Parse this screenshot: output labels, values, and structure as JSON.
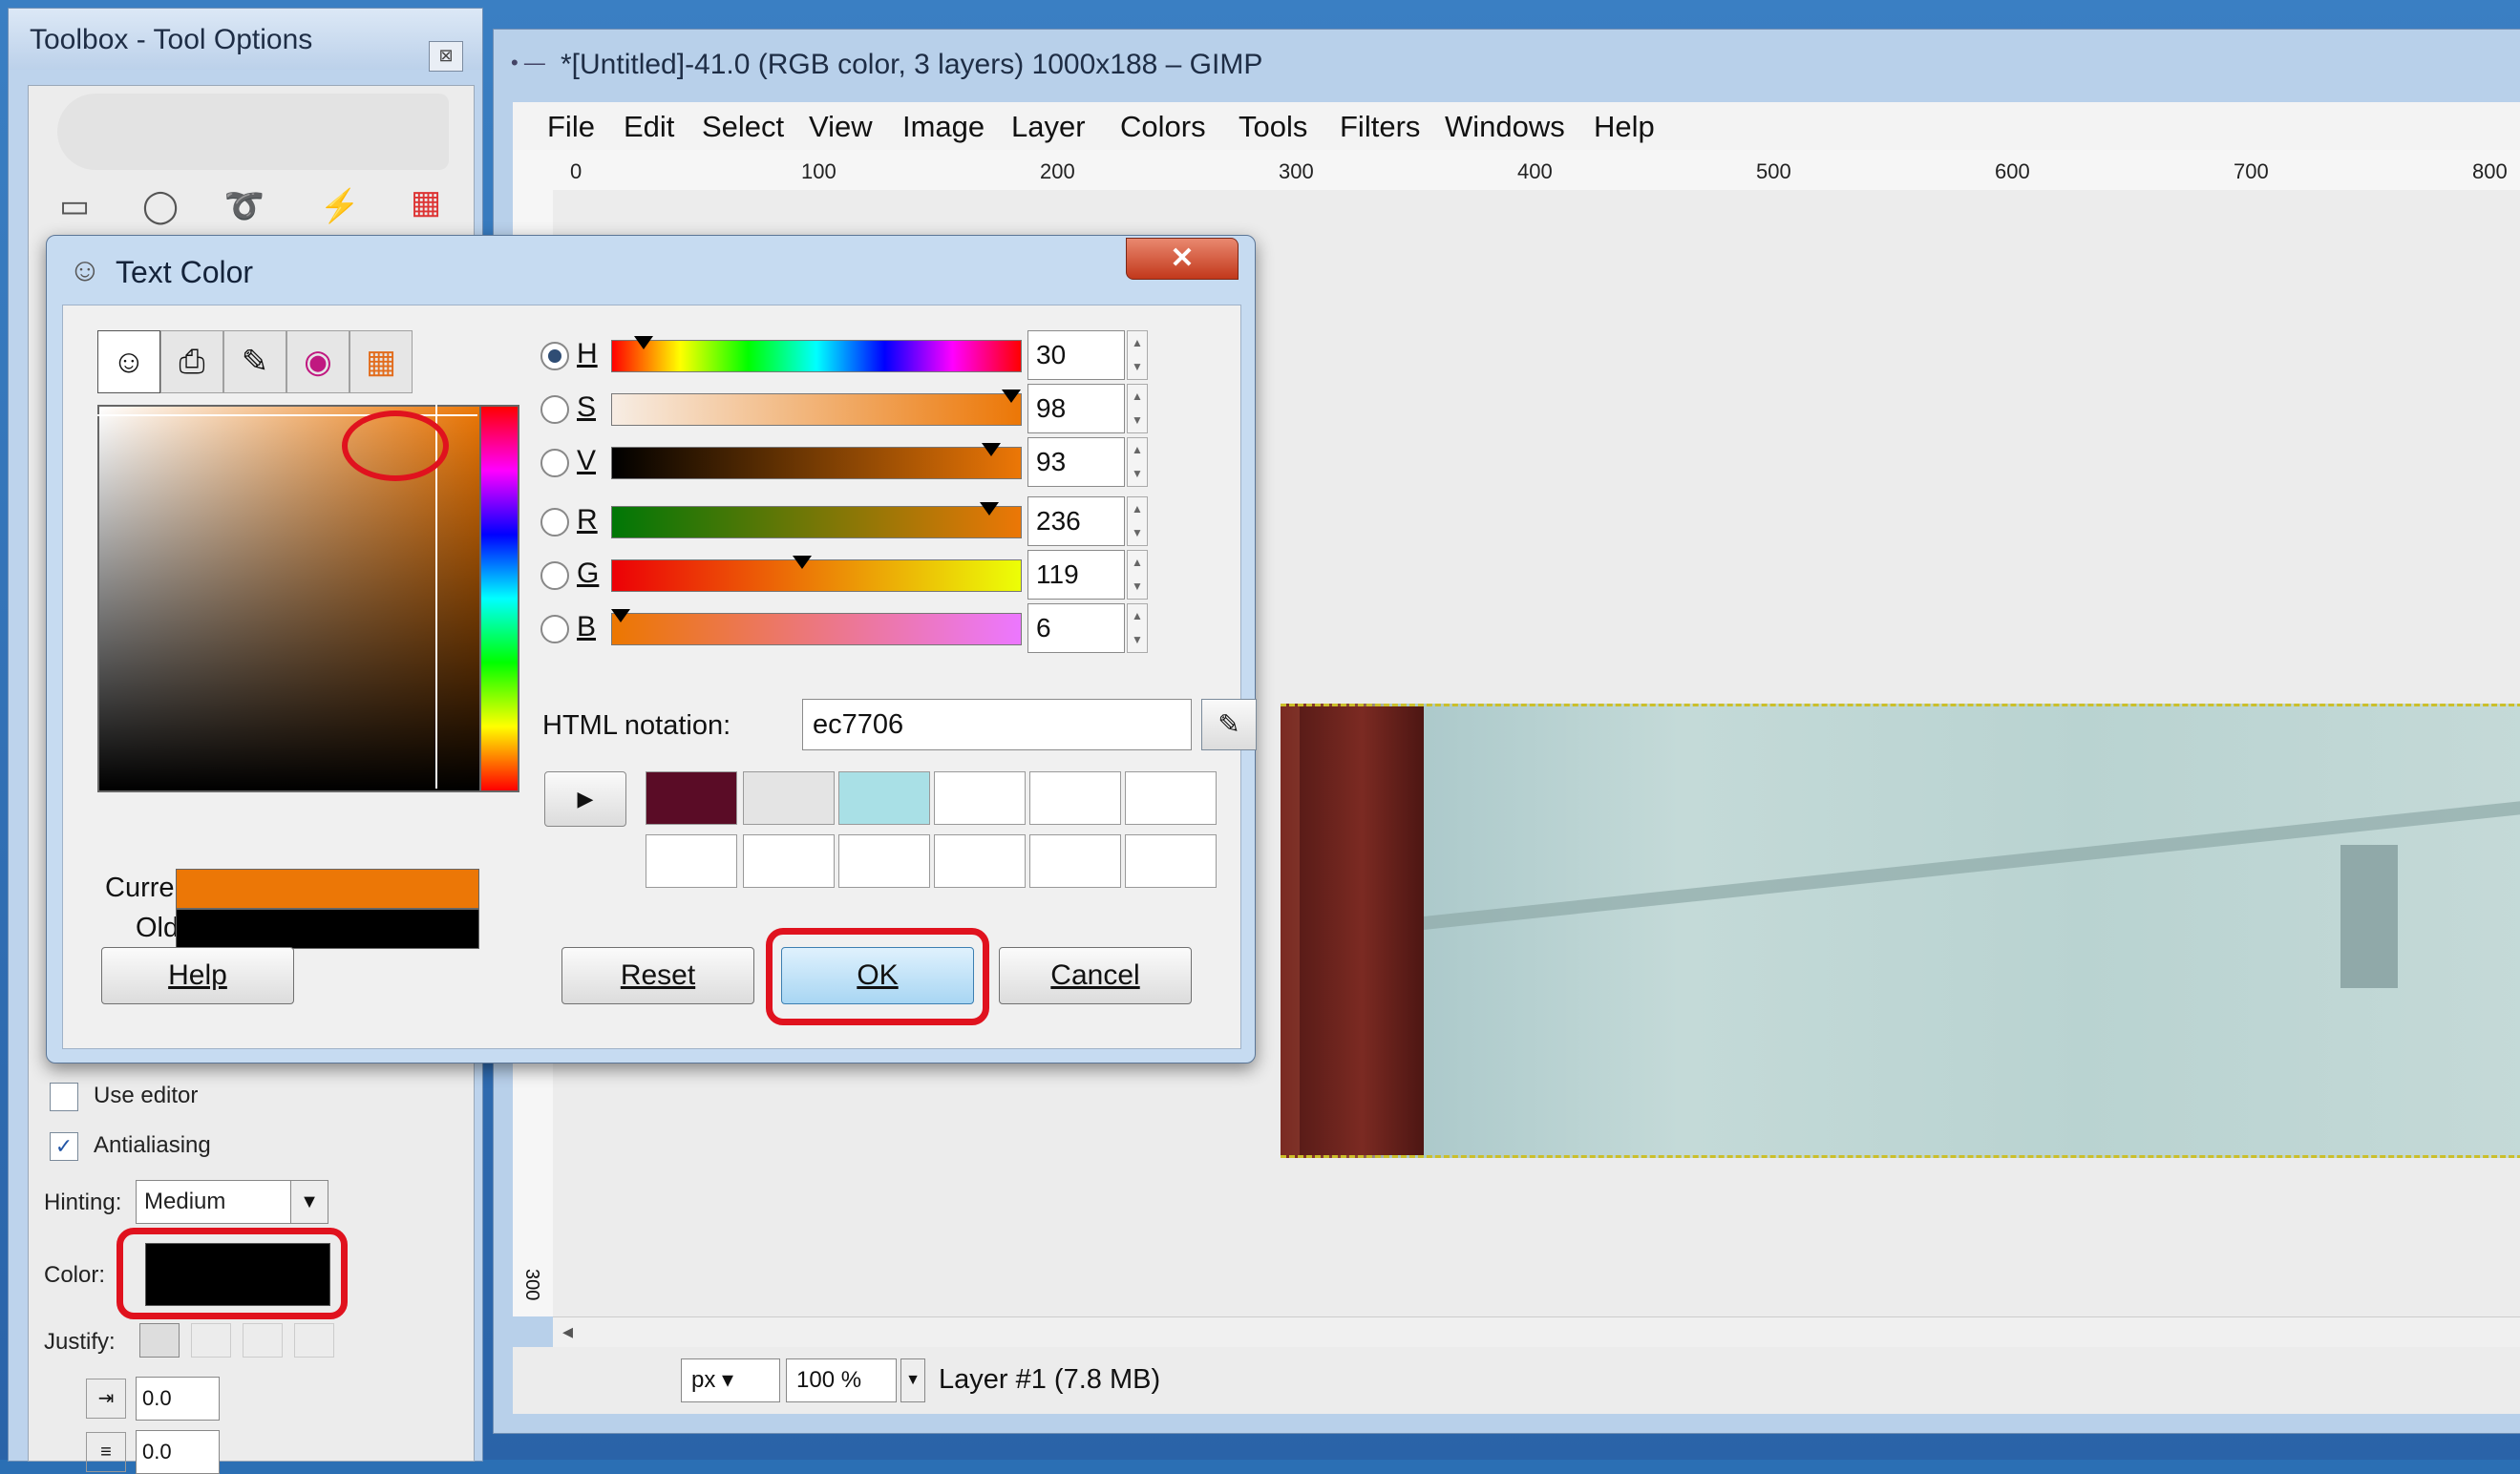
{
  "toolbox": {
    "title": "Toolbox - Tool Options",
    "close_label": "⊠",
    "tools": [
      "rect-select-icon",
      "ellipse-select-icon",
      "free-select-icon",
      "fuzzy-select-icon",
      "color-select-icon"
    ],
    "options": {
      "use_editor_label": "Use editor",
      "use_editor_checked": false,
      "antialiasing_label": "Antialiasing",
      "antialiasing_checked": true,
      "hinting_label": "Hinting:",
      "hinting_value": "Medium",
      "color_label": "Color:",
      "color_value": "#000000",
      "justify_label": "Justify:",
      "indent_value": "0.0",
      "line_spacing_value": "0.0"
    }
  },
  "main_window": {
    "title": "*[Untitled]-41.0 (RGB color, 3 layers) 1000x188 – GIMP",
    "menus": [
      "File",
      "Edit",
      "Select",
      "View",
      "Image",
      "Layer",
      "Colors",
      "Tools",
      "Filters",
      "Windows",
      "Help"
    ],
    "ruler_ticks": [
      "0",
      "100",
      "200",
      "300",
      "400",
      "500",
      "600",
      "700",
      "800"
    ],
    "vertical_ruler_label": "300",
    "status": {
      "unit": "px",
      "zoom": "100 %",
      "layer_info": "Layer #1 (7.8 MB)"
    }
  },
  "dialog": {
    "title": "Text Color",
    "close_label": "✕",
    "tabs": [
      "gimp-selector-icon",
      "printer-cmyk-icon",
      "watercolor-brush-icon",
      "color-wheel-icon",
      "palette-icon"
    ],
    "channels": [
      {
        "label": "H",
        "value": "30",
        "selected": true,
        "marker": 0.08
      },
      {
        "label": "S",
        "value": "98",
        "selected": false,
        "marker": 0.98
      },
      {
        "label": "V",
        "value": "93",
        "selected": false,
        "marker": 0.93
      },
      {
        "label": "R",
        "value": "236",
        "selected": false,
        "marker": 0.925
      },
      {
        "label": "G",
        "value": "119",
        "selected": false,
        "marker": 0.467
      },
      {
        "label": "B",
        "value": "6",
        "selected": false,
        "marker": 0.024
      }
    ],
    "html_notation_label": "HTML notation:",
    "html_notation_value": "ec7706",
    "current_label": "Current:",
    "old_label": "Old:",
    "current_color": "#ec7706",
    "old_color": "#000000",
    "history_colors": [
      "#5a0c26",
      "#e4e4e4",
      "#a9e0e6",
      "#ffffff",
      "#ffffff",
      "#ffffff",
      "#ffffff",
      "#ffffff",
      "#ffffff",
      "#ffffff",
      "#ffffff",
      "#ffffff"
    ],
    "buttons": {
      "help": "Help",
      "reset": "Reset",
      "ok": "OK",
      "cancel": "Cancel"
    }
  },
  "highlight_color": "#e0121e"
}
